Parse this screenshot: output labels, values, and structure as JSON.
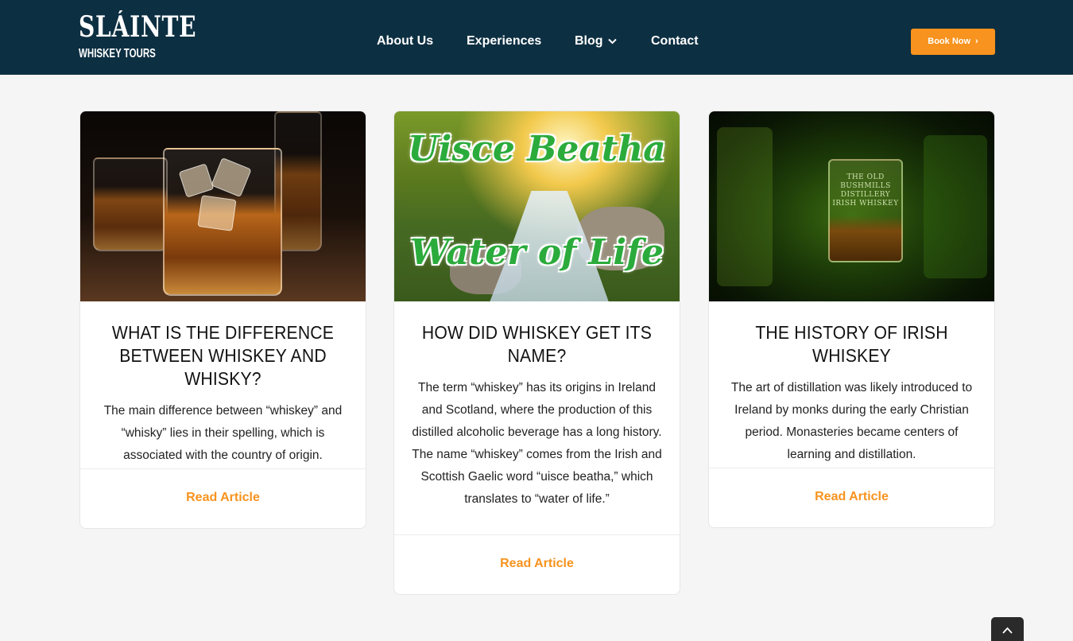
{
  "header": {
    "logo_top": "SLÁINTE",
    "logo_bottom": "WHISKEY TOURS",
    "nav": [
      "About Us",
      "Experiences",
      "Blog",
      "Contact"
    ],
    "book_label": "Book Now",
    "colors": {
      "header_bg": "#0d2f42",
      "accent": "#f7931e"
    }
  },
  "cards": [
    {
      "title": "WHAT IS THE DIFFERENCE BETWEEN WHISKEY AND WHISKY?",
      "text": "The main difference between “whiskey” and “whisky” lies in their spelling, which is associated with the country of origin.",
      "link": "Read Article"
    },
    {
      "image_text_1": "Uisce Beatha",
      "image_text_2": "Water of Life",
      "title": "HOW DID WHISKEY GET ITS NAME?",
      "text": "The term “whiskey” has its origins in Ireland and Scotland, where the production of this distilled alcoholic beverage has a long history. The name “whiskey” comes from the Irish and Scottish Gaelic word “uisce beatha,” which translates to “water of life.”",
      "link": "Read Article"
    },
    {
      "image_text": "THE OLD BUSHMILLS DISTILLERY IRISH WHISKEY",
      "title": "THE HISTORY OF IRISH WHISKEY",
      "text": "The art of distillation was likely introduced to Ireland by monks during the early Christian period. Monasteries became centers of learning and distillation.",
      "link": "Read Article"
    }
  ],
  "icons": {
    "blog_dropdown": "chevron-down-icon",
    "book_arrow": "chevron-right-icon",
    "to_top": "chevron-up-icon"
  }
}
